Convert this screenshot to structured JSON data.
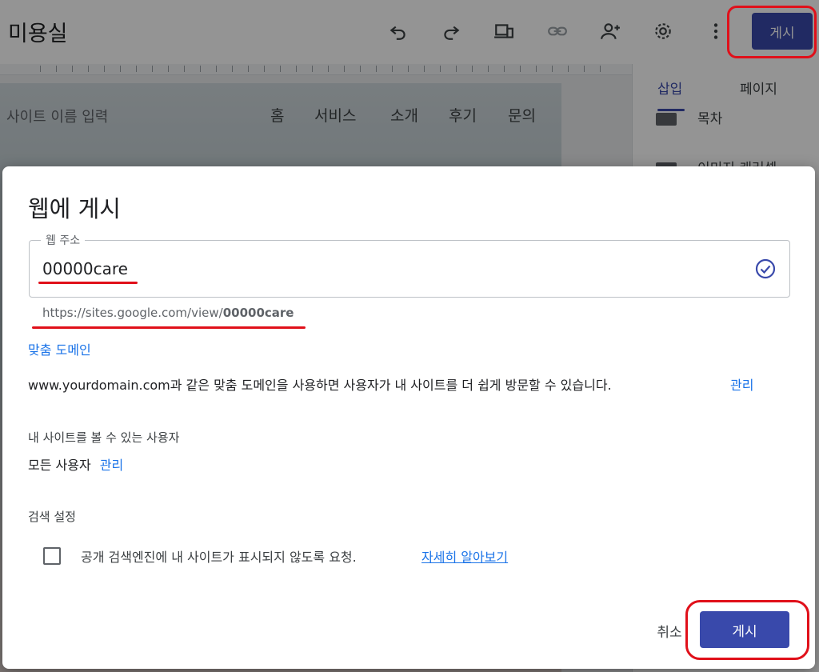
{
  "editor": {
    "doc_title": "미용실",
    "publish_label": "게시",
    "site_name_placeholder": "사이트 이름 입력",
    "nav": [
      "홈",
      "서비스",
      "소개",
      "후기",
      "문의"
    ],
    "side_tabs": [
      "삽입",
      "페이지"
    ],
    "side_items": [
      "목차",
      "이미지 캐러셀"
    ],
    "icons": [
      "undo-icon",
      "redo-icon",
      "device-preview-icon",
      "link-icon",
      "add-person-icon",
      "gear-icon",
      "more-vert-icon"
    ]
  },
  "dialog": {
    "title": "웹에 게시",
    "address_label": "웹 주소",
    "address_value": "00000care",
    "url_prefix": "https://sites.google.com/view/",
    "url_suffix": "00000care",
    "custom_domain_heading": "맞춤 도메인",
    "custom_domain_desc": "www.yourdomain.com과 같은 맞춤 도메인을 사용하면 사용자가 내 사이트를 더 쉽게 방문할 수 있습니다.",
    "manage_label": "관리",
    "viewers_heading": "내 사이트를 볼 수 있는 사용자",
    "viewers_value": "모든 사용자",
    "viewers_manage": "관리",
    "search_heading": "검색 설정",
    "search_checkbox_label": "공개 검색엔진에 내 사이트가 표시되지 않도록 요청.",
    "learn_more": "자세히 알아보기",
    "cancel_label": "취소",
    "publish_label": "게시",
    "search_opt_out_checked": false
  },
  "colors": {
    "accent": "#3949ab",
    "link": "#1a73e8",
    "annotation": "#e0101a"
  }
}
